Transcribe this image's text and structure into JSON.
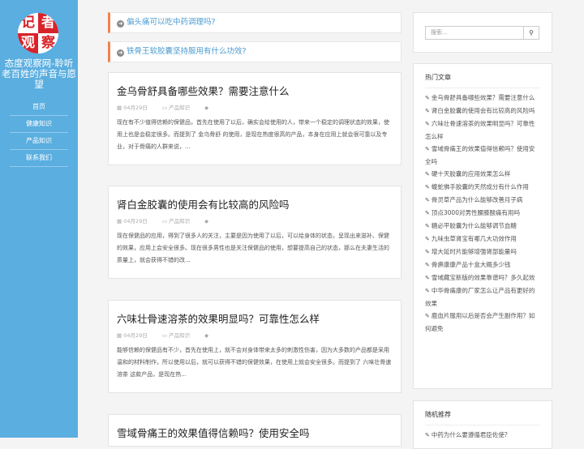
{
  "sidebar": {
    "logo_chars": [
      "记",
      "者",
      "观",
      "察"
    ],
    "site_title": "态度观察网-聆听老百姓的声音与愿望",
    "nav": [
      "首页",
      "健康知识",
      "产品知识",
      "联系我们"
    ]
  },
  "notices": [
    "偏头痛可以吃中药调理吗?",
    "铁骨王软胶囊坚持服用有什么功效?"
  ],
  "posts": [
    {
      "title": "金乌骨舒具备哪些效果？需要注意什么",
      "date": "04月29日",
      "category": "产品知识",
      "excerpt": "现在有不少值得信赖的保健品，首先在使用了以后，确实会给使用的人，带来一个稳定的调理状态的效果，使用上也是会稳定很多。而提到了 金乌骨舒 的使用，是现在热度很高的产品，本身在应用上就会很可靠以及专业，对于骨痛的人群来说，..."
    },
    {
      "title": "肾白金胶囊的使用会有比较高的风险吗",
      "date": "04月29日",
      "category": "产品知识",
      "excerpt": "现在保健品的应用，得到了很多人的关注，主要是因为使用了以后，可以给身体的状态，呈现出来滋补、保健的效果，应用上会安全很多。现在很多男性也是关注保健品的使用，想要提高自己的状态，那么在夫妻生活的质量上，就会获得不错的改..."
    },
    {
      "title": "六味壮骨速溶茶的效果明显吗？可靠性怎么样",
      "date": "04月29日",
      "category": "产品知识",
      "excerpt": "能够信赖的保健品有不少，首先在使用上，就不会对身体带来太多的刺激性伤害，因为大多数的产品都是采用温和的材料制作，所以使用以后，就可以获得不错的保健效果，在使用上就会安全很多。而提到了 六味壮骨速溶茶 这款产品，是现在热..."
    },
    {
      "title": "雪域骨痛王的效果值得信赖吗？使用安全吗",
      "date": "",
      "category": "",
      "excerpt": ""
    }
  ],
  "search": {
    "placeholder": "搜索...",
    "button_icon": "search-icon"
  },
  "hot_articles": {
    "title": "热门文章",
    "items": [
      "金乌骨舒具备哪些效果？需要注意什么",
      "肾白金胶囊的使用会有比较高的风险吗",
      "六味壮骨速溶茶的效果明显吗？可靠性怎么样",
      "雪域骨痛王的效果值得信赖吗？使用安全吗",
      "硬十天胶囊的应用效果怎么样",
      "蝮蛇佛手胶囊的天然成分有什么作用",
      "骨灵草产品为什么能够改善月子病",
      "顶点3000对男性腰膝酸痛有用吗",
      "糖必平胶囊为什么能够调节血糖",
      "九味虫草肾宝有哪几大功效作用",
      "增大延时片能够增强肾部能量吗",
      "骨痹康康产品十盒大概多少钱",
      "雪域藏宝新版的效果靠谱吗？多久起效",
      "中华骨痛康的厂家怎么让产品有更好的效果",
      "鹿血片服用以后是否会产生副作用？如何避免"
    ]
  },
  "random": {
    "title": "随机推荐",
    "items": [
      "中药为什么要遵循君臣佐使?"
    ]
  },
  "colors": {
    "sidebar": "#5aaee0",
    "notice_border": "#f0834e",
    "link": "#4a9bd0"
  }
}
